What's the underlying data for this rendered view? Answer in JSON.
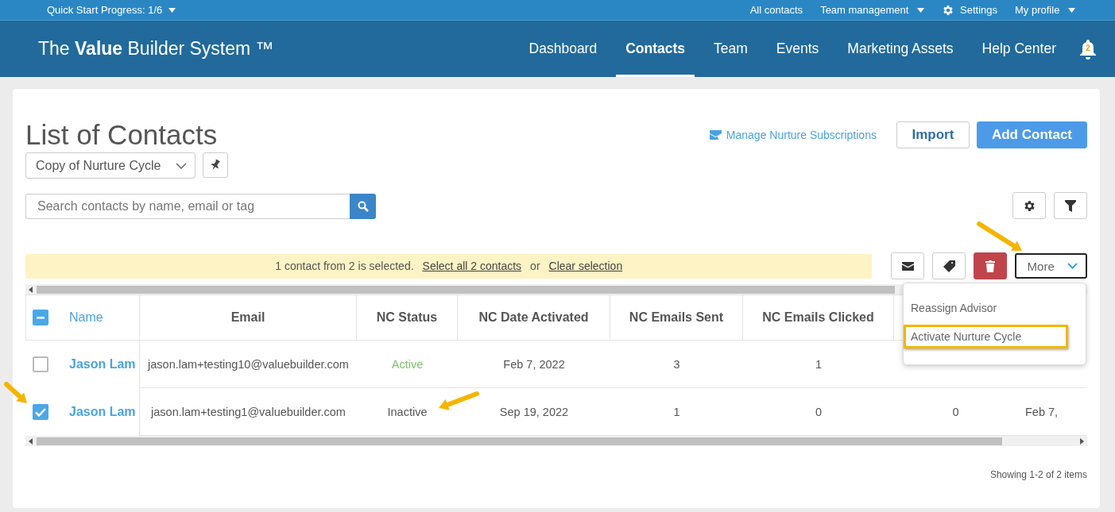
{
  "top_bar": {
    "quick_start": "Quick Start Progress: 1/6",
    "links": [
      {
        "label": "All contacts",
        "kind": "link"
      },
      {
        "label": "Team management",
        "kind": "dropdown"
      },
      {
        "label": "Settings",
        "kind": "settings"
      },
      {
        "label": "My profile",
        "kind": "dropdown"
      }
    ]
  },
  "header": {
    "brand": "The **Value** Builder System ™",
    "nav": [
      {
        "label": "Dashboard",
        "selected": false
      },
      {
        "label": "Contacts",
        "selected": true
      },
      {
        "label": "Team",
        "selected": false
      },
      {
        "label": "Events",
        "selected": false
      },
      {
        "label": "Marketing Assets",
        "selected": false
      },
      {
        "label": "Help Center",
        "selected": false
      }
    ],
    "notification_count": "2"
  },
  "page": {
    "title": "List of Contacts",
    "view_select": "Copy of Nurture Cycle",
    "manage_link": "Manage Nurture Subscriptions",
    "buttons": [
      {
        "label": "Import",
        "kind": "secondary"
      },
      {
        "label": "Add Contact",
        "kind": "primary"
      }
    ],
    "search": {
      "placeholder": "Search contacts by name, email or tag"
    }
  },
  "selection_bar": {
    "message": "1 contact from 2 is selected.",
    "select_all": "Select all 2 contacts",
    "or": "or",
    "clear": "Clear selection"
  },
  "more_button": "More",
  "more_menu": [
    {
      "label": "Reassign Advisor",
      "highlighted": false
    },
    {
      "label": "Activate Nurture Cycle",
      "highlighted": true
    }
  ],
  "table": {
    "select_all_partial": true,
    "columns": [
      "Name",
      "Email",
      "NC Status",
      "NC Date Activated",
      "NC Emails Sent",
      "NC Emails Clicked"
    ],
    "rows": [
      {
        "checked": false,
        "name": "Jason Lam",
        "email": "jason.lam+testing10@valuebuilder.com",
        "status": "Active",
        "active": true,
        "date": "Feb 7, 2022",
        "sent": "3",
        "clicked": "1"
      },
      {
        "checked": true,
        "name": "Jason Lam",
        "email": "jason.lam+testing1@valuebuilder.com",
        "status": "Inactive",
        "active": false,
        "date": "Sep 19, 2022",
        "sent": "1",
        "clicked": "0",
        "column_7": "0",
        "column_8": "Feb 7,"
      }
    ]
  },
  "footer": "Showing 1-2 of 2 items"
}
